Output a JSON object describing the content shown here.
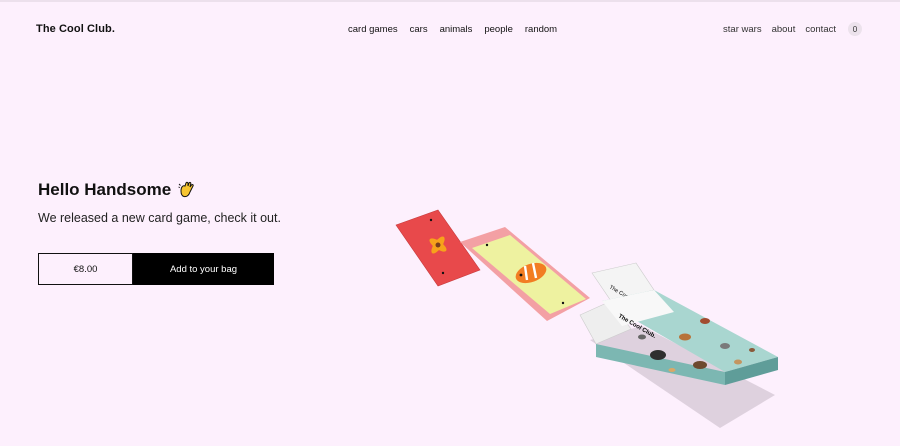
{
  "header": {
    "logo": "The Cool Club.",
    "nav_center": [
      "card games",
      "cars",
      "animals",
      "people",
      "random"
    ],
    "nav_right": [
      "star wars",
      "about",
      "contact"
    ],
    "cart_count": "0"
  },
  "hero": {
    "title": "Hello Handsome",
    "subtitle": "We released a new card game, check it out.",
    "price": "€8.00",
    "cta_label": "Add to your bag"
  },
  "product_box": {
    "brand_text": "The Cool Club."
  },
  "colors": {
    "background": "#fdf0fd",
    "button": "#000000",
    "card_red": "#e8494b",
    "card_pink": "#f3a0a4",
    "card_yellow": "#eef2a0",
    "box_teal": "#a9d6d0"
  },
  "icons": {
    "hero": "waving-hand-icon"
  }
}
